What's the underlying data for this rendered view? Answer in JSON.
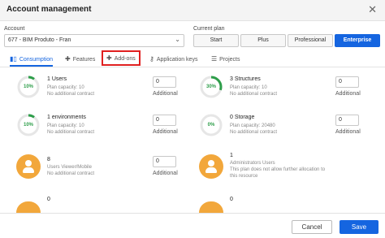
{
  "dialog": {
    "title": "Account management"
  },
  "account": {
    "label": "Account",
    "value": "677 - BIM Produto - Fran"
  },
  "plan": {
    "label": "Current plan",
    "options": [
      "Start",
      "Plus",
      "Professional",
      "Enterprise"
    ],
    "selected": "Enterprise"
  },
  "tabs": [
    {
      "label": "Consumption",
      "icon": "bar-chart-icon"
    },
    {
      "label": "Features",
      "icon": "puzzle-icon"
    },
    {
      "label": "Add-ons",
      "icon": "puzzle-icon"
    },
    {
      "label": "Application keys",
      "icon": "key-icon"
    },
    {
      "label": "Projects",
      "icon": "list-icon"
    }
  ],
  "items": {
    "users": {
      "percent": "10%",
      "title": "1 Users",
      "capacity": "Plan capacity: 10",
      "contract": "No additional contract",
      "input_value": "0",
      "additional_label": "Additional"
    },
    "structures": {
      "percent": "30%",
      "title": "3 Structures",
      "capacity": "Plan capacity: 10",
      "contract": "No additional contract",
      "input_value": "0",
      "additional_label": "Additional"
    },
    "environments": {
      "percent": "10%",
      "title": "1 environments",
      "capacity": "Plan capacity: 10",
      "contract": "No additional contract",
      "input_value": "0",
      "additional_label": "Additional"
    },
    "storage": {
      "percent": "0%",
      "title": "0 Storage",
      "capacity": "Plan capacity: 20480",
      "contract": "No additional contract",
      "input_value": "0",
      "additional_label": "Additional"
    },
    "viewers": {
      "title": "8",
      "subtitle": "Users Viewer/Mobile",
      "contract": "No additional contract",
      "input_value": "0",
      "additional_label": "Additional"
    },
    "administrators": {
      "title": "1",
      "subtitle": "Administrators Users",
      "note_line1": "This plan does not allow further allocation to",
      "note_line2": "this resource"
    },
    "left_bottom": {
      "title": "0"
    },
    "right_bottom": {
      "title": "0"
    }
  },
  "footer": {
    "cancel": "Cancel",
    "save": "Save"
  },
  "colors": {
    "accent": "#1565e0",
    "gauge": "#2e9e4a",
    "avatar": "#f2a73b",
    "highlight": "#e02020"
  }
}
